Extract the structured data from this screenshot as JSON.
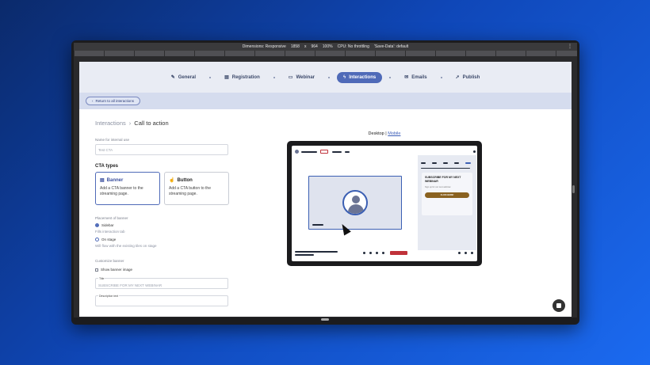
{
  "devtools": {
    "dimensions_label": "Dimensions: Responsive",
    "width": "1858",
    "times": "x",
    "height": "964",
    "zoom": "100%",
    "cpu": "CPU: No throttling",
    "save_data": "'Save-Data': default"
  },
  "steps": [
    {
      "label": "General",
      "icon": "pencil-icon"
    },
    {
      "label": "Registration",
      "icon": "form-icon"
    },
    {
      "label": "Webinar",
      "icon": "screen-icon"
    },
    {
      "label": "Interactions",
      "icon": "bolt-icon",
      "active": true
    },
    {
      "label": "Emails",
      "icon": "mail-icon"
    },
    {
      "label": "Publish",
      "icon": "rocket-icon"
    }
  ],
  "return_label": "Return to all interactions",
  "breadcrumb": {
    "parent": "Interactions",
    "current": "Call to action"
  },
  "internal_name": {
    "label": "Name for internal use",
    "value": "Test CTA"
  },
  "cta_types": {
    "heading": "CTA types",
    "banner": {
      "title": "Banner",
      "desc": "Add a CTA banner to the streaming page."
    },
    "button": {
      "title": "Button",
      "desc": "Add a CTA button to the streaming page."
    }
  },
  "placement": {
    "label": "Placement of banner",
    "sidebar": "Sidebar",
    "sidebar_hint": "Fills interaction tab",
    "onstage": "On stage",
    "onstage_hint": "Will flow with the existing tiles on stage"
  },
  "customize": {
    "label": "Customize banner",
    "show_image": "Show banner image",
    "title_label": "Title",
    "title_value": "SUBSCRIBE FOR MY NEXT WEBINAR",
    "desc_label": "Description text"
  },
  "preview": {
    "desktop": "Desktop",
    "divider": "|",
    "mobile": "Mobile",
    "card_title": "SUBSCRIBE FOR MY NEXT WEBINAR",
    "card_sub": "Sign up for our next webinar.",
    "card_button": "CLICK HERE!"
  },
  "colors": {
    "accent": "#4f6ab8",
    "cta": "#8a6220",
    "stop": "#c0323a"
  }
}
